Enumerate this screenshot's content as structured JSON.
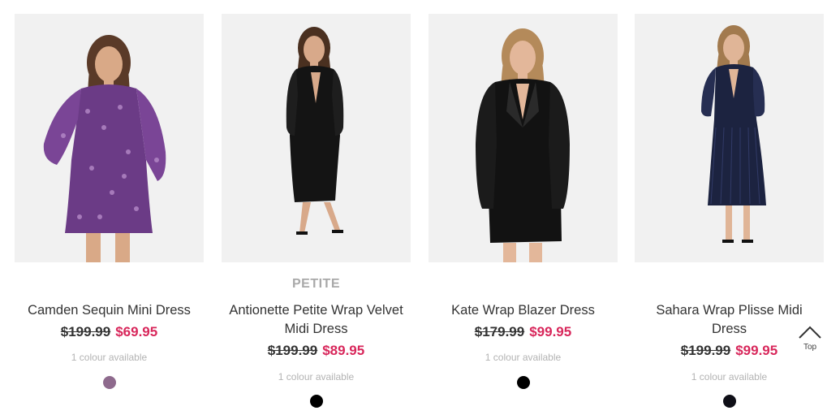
{
  "products": [
    {
      "badge": "",
      "name": "Camden Sequin Mini Dress",
      "price_old": "$199.99",
      "price_new": "$69.95",
      "colours": "1 colour available",
      "swatch_color": "#8e6a8d",
      "dress_color": "#6b3b86",
      "dress_style": "sequin-mini",
      "hair_color": "#5a3a28"
    },
    {
      "badge": "PETITE",
      "name": "Antionette Petite Wrap Velvet Midi Dress",
      "price_old": "$199.99",
      "price_new": "$89.95",
      "colours": "1 colour available",
      "swatch_color": "#000000",
      "dress_color": "#141414",
      "dress_style": "velvet-midi",
      "hair_color": "#4a3020"
    },
    {
      "badge": "",
      "name": "Kate Wrap Blazer Dress",
      "price_old": "$179.99",
      "price_new": "$99.95",
      "colours": "1 colour available",
      "swatch_color": "#000000",
      "dress_color": "#121212",
      "dress_style": "blazer",
      "hair_color": "#b48a5a"
    },
    {
      "badge": "",
      "name": "Sahara Wrap Plisse Midi Dress",
      "price_old": "$199.99",
      "price_new": "$99.95",
      "colours": "1 colour available",
      "swatch_color": "#0f0f17",
      "dress_color": "#1c2340",
      "dress_style": "plisse-midi",
      "hair_color": "#a27a4e"
    }
  ],
  "back_to_top": {
    "label": "Top",
    "icon": "chevron-up-icon"
  }
}
